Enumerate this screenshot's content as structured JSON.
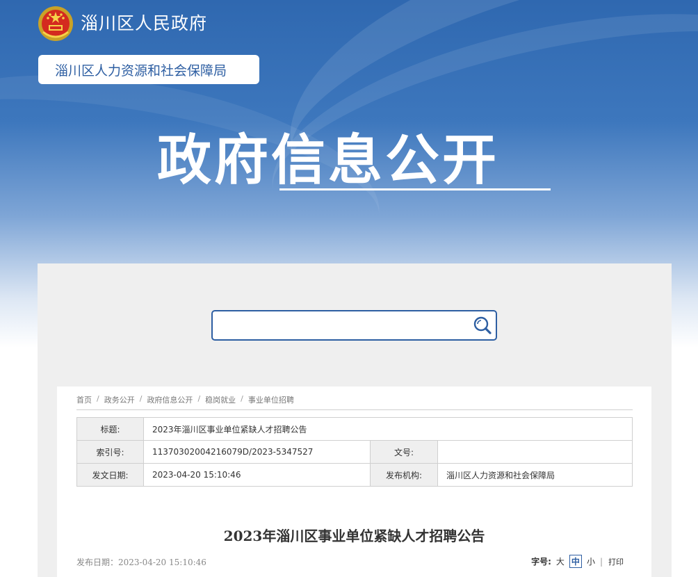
{
  "header": {
    "site_name": "淄川区人民政府",
    "department": "淄川区人力资源和社会保障局",
    "section_title": "政府信息公开"
  },
  "search": {
    "value": "",
    "placeholder": ""
  },
  "breadcrumb": [
    "首页",
    "政务公开",
    "政府信息公开",
    "稳岗就业",
    "事业单位招聘"
  ],
  "meta": {
    "title_label": "标题:",
    "title_value": "2023年淄川区事业单位紧缺人才招聘公告",
    "index_label": "索引号:",
    "index_value": "11370302004216079D/2023-5347527",
    "docno_label": "文号:",
    "docno_value": "",
    "date_label": "发文日期:",
    "date_value": "2023-04-20 15:10:46",
    "org_label": "发布机构:",
    "org_value": "淄川区人力资源和社会保障局"
  },
  "article": {
    "title": "2023年淄川区事业单位紧缺人才招聘公告",
    "pub_date": "发布日期：2023-04-20 15:10:46"
  },
  "font_tools": {
    "label": "字号:",
    "large": "大",
    "medium": "中",
    "small": "小",
    "separator": "|",
    "print": "打印"
  },
  "colors": {
    "brand_blue": "#2d5ea2",
    "panel_gray": "#efefef"
  }
}
